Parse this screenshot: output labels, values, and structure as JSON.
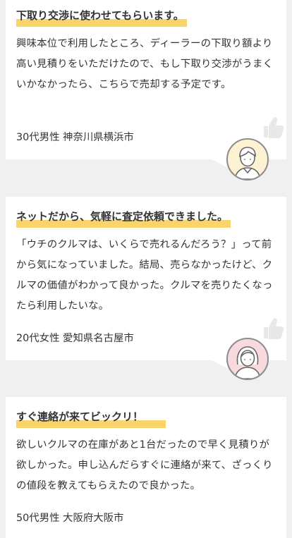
{
  "testimonials": [
    {
      "title": "下取り交渉に使わせてもらいます。",
      "body": "興味本位で利用したところ、ディーラーの下取り額より高い見積りをいただけたので、もし下取り交渉がうまくいかなかったら、こちらで売却する予定です。",
      "meta": "30代男性 神奈川県横浜市",
      "avatar": "male-avatar"
    },
    {
      "title": "ネットだから、気軽に査定依頼できました。",
      "body": "「ウチのクルマは、いくらで売れるんだろう？」って前から気になっていました。結局、売らなかったけど、クルマの価値がわかって良かった。クルマを売りたくなったら利用したいな。",
      "meta": "20代女性 愛知県名古屋市",
      "avatar": "female-avatar"
    },
    {
      "title": "すぐ連絡が来てビックリ！",
      "body": "欲しいクルマの在庫があと1台だったので早く見積りが欲しかった。申し込んだらすぐに連絡が来て、ざっくりの値段を教えてもらえたので良かった。",
      "meta": "50代男性 大阪府大阪市"
    }
  ],
  "colors": {
    "highlight": "#f9d46b",
    "background": "#f0f0f0",
    "card": "#ffffff",
    "text": "#333333"
  },
  "icons": [
    "thumbs-up-icon",
    "male-avatar-icon",
    "female-avatar-icon"
  ]
}
